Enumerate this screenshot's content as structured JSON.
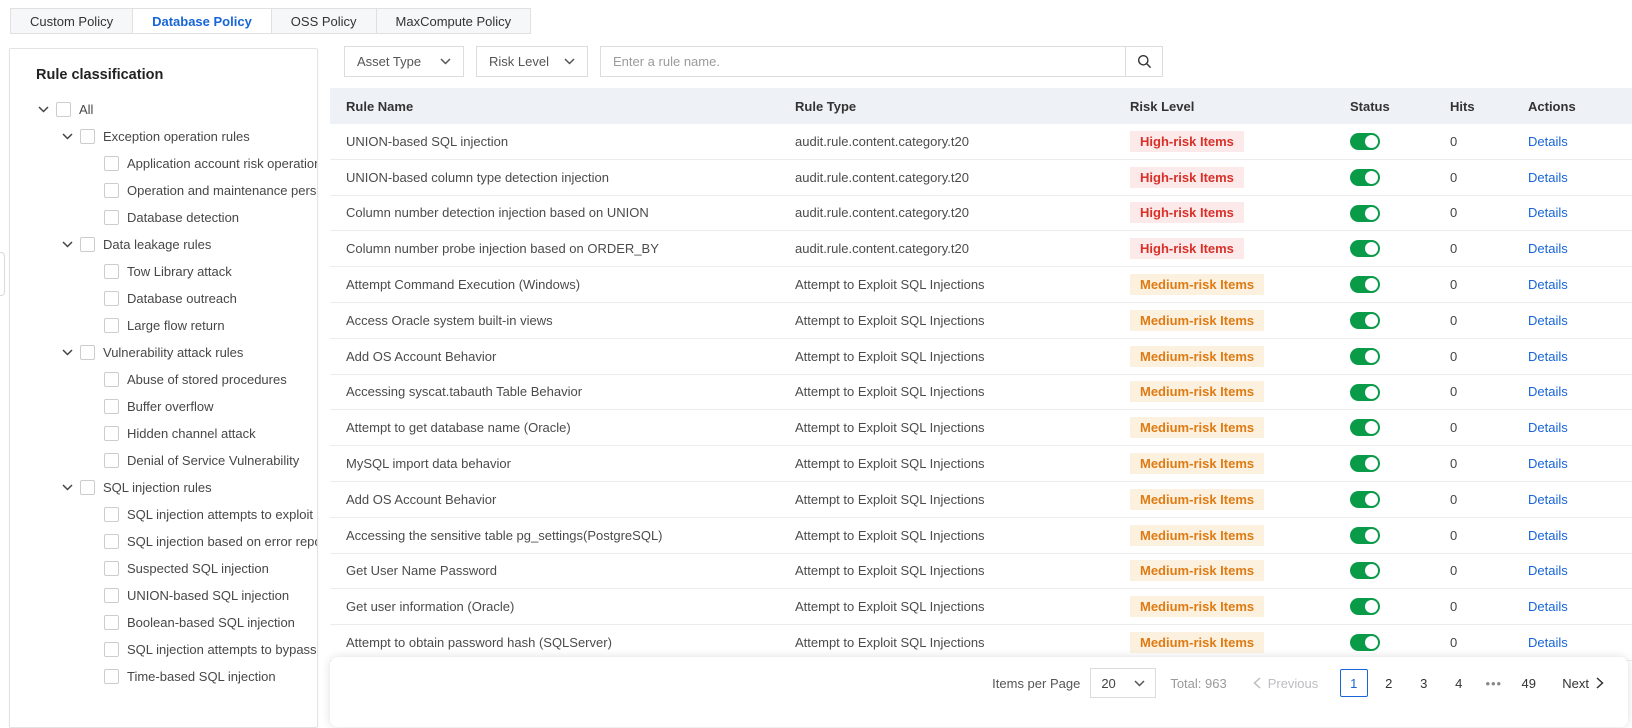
{
  "colors": {
    "accent_blue": "#1765D8",
    "toggle_on_green": "#0A9B49",
    "high_risk_text": "#D9312A",
    "high_risk_bg": "#FCE9E9",
    "medium_risk_text": "#DE7B12",
    "medium_risk_bg": "#FCF0DF",
    "table_header_bg": "#EEF1F6"
  },
  "tabs": [
    {
      "label": "Custom Policy",
      "active": false
    },
    {
      "label": "Database Policy",
      "active": true
    },
    {
      "label": "OSS Policy",
      "active": false
    },
    {
      "label": "MaxCompute Policy",
      "active": false
    }
  ],
  "sidebar": {
    "title": "Rule classification",
    "tree": [
      {
        "label": "All",
        "level": 0,
        "expandable": true,
        "expanded": true
      },
      {
        "label": "Exception operation rules",
        "level": 1,
        "expandable": true,
        "expanded": true
      },
      {
        "label": "Application account risk operation",
        "level": 2,
        "expandable": false
      },
      {
        "label": "Operation and maintenance personnel ri",
        "level": 2,
        "expandable": false
      },
      {
        "label": "Database detection",
        "level": 2,
        "expandable": false
      },
      {
        "label": "Data leakage rules",
        "level": 1,
        "expandable": true,
        "expanded": true
      },
      {
        "label": "Tow Library attack",
        "level": 2,
        "expandable": false
      },
      {
        "label": "Database outreach",
        "level": 2,
        "expandable": false
      },
      {
        "label": "Large flow return",
        "level": 2,
        "expandable": false
      },
      {
        "label": "Vulnerability attack rules",
        "level": 1,
        "expandable": true,
        "expanded": true
      },
      {
        "label": "Abuse of stored procedures",
        "level": 2,
        "expandable": false
      },
      {
        "label": "Buffer overflow",
        "level": 2,
        "expandable": false
      },
      {
        "label": "Hidden channel attack",
        "level": 2,
        "expandable": false
      },
      {
        "label": "Denial of Service Vulnerability",
        "level": 2,
        "expandable": false
      },
      {
        "label": "SQL injection rules",
        "level": 1,
        "expandable": true,
        "expanded": true
      },
      {
        "label": "SQL injection attempts to exploit",
        "level": 2,
        "expandable": false
      },
      {
        "label": "SQL injection based on error reporting",
        "level": 2,
        "expandable": false
      },
      {
        "label": "Suspected SQL injection",
        "level": 2,
        "expandable": false
      },
      {
        "label": "UNION-based SQL injection",
        "level": 2,
        "expandable": false
      },
      {
        "label": "Boolean-based SQL injection",
        "level": 2,
        "expandable": false
      },
      {
        "label": "SQL injection attempts to bypass",
        "level": 2,
        "expandable": false
      },
      {
        "label": "Time-based SQL injection",
        "level": 2,
        "expandable": false
      }
    ]
  },
  "filters": {
    "asset_type_label": "Asset Type",
    "risk_level_label": "Risk Level",
    "search_placeholder": "Enter a rule name."
  },
  "table": {
    "columns": [
      "Rule Name",
      "Rule Type",
      "Risk Level",
      "Status",
      "Hits",
      "Actions"
    ],
    "risk_labels": {
      "high": "High-risk Items",
      "medium": "Medium-risk Items"
    },
    "action_label": "Details",
    "rows": [
      {
        "name": "UNION-based SQL injection",
        "type": "audit.rule.content.category.t20",
        "risk": "high",
        "status": "on",
        "hits": "0"
      },
      {
        "name": "UNION-based column type detection injection",
        "type": "audit.rule.content.category.t20",
        "risk": "high",
        "status": "on",
        "hits": "0"
      },
      {
        "name": "Column number detection injection based on UNION",
        "type": "audit.rule.content.category.t20",
        "risk": "high",
        "status": "on",
        "hits": "0"
      },
      {
        "name": "Column number probe injection based on ORDER_BY",
        "type": "audit.rule.content.category.t20",
        "risk": "high",
        "status": "on",
        "hits": "0"
      },
      {
        "name": "Attempt Command Execution (Windows)",
        "type": "Attempt to Exploit SQL Injections",
        "risk": "medium",
        "status": "on",
        "hits": "0"
      },
      {
        "name": "Access Oracle system built-in views",
        "type": "Attempt to Exploit SQL Injections",
        "risk": "medium",
        "status": "on",
        "hits": "0"
      },
      {
        "name": "Add OS Account Behavior",
        "type": "Attempt to Exploit SQL Injections",
        "risk": "medium",
        "status": "on",
        "hits": "0"
      },
      {
        "name": "Accessing syscat.tabauth Table Behavior",
        "type": "Attempt to Exploit SQL Injections",
        "risk": "medium",
        "status": "on",
        "hits": "0"
      },
      {
        "name": "Attempt to get database name (Oracle)",
        "type": "Attempt to Exploit SQL Injections",
        "risk": "medium",
        "status": "on",
        "hits": "0"
      },
      {
        "name": "MySQL import data behavior",
        "type": "Attempt to Exploit SQL Injections",
        "risk": "medium",
        "status": "on",
        "hits": "0"
      },
      {
        "name": "Add OS Account Behavior",
        "type": "Attempt to Exploit SQL Injections",
        "risk": "medium",
        "status": "on",
        "hits": "0"
      },
      {
        "name": "Accessing the sensitive table pg_settings(PostgreSQL)",
        "type": "Attempt to Exploit SQL Injections",
        "risk": "medium",
        "status": "on",
        "hits": "0"
      },
      {
        "name": "Get User Name Password",
        "type": "Attempt to Exploit SQL Injections",
        "risk": "medium",
        "status": "on",
        "hits": "0"
      },
      {
        "name": "Get user information (Oracle)",
        "type": "Attempt to Exploit SQL Injections",
        "risk": "medium",
        "status": "on",
        "hits": "0"
      },
      {
        "name": "Attempt to obtain password hash (SQLServer)",
        "type": "Attempt to Exploit SQL Injections",
        "risk": "medium",
        "status": "on",
        "hits": "0"
      }
    ]
  },
  "pagination": {
    "items_per_page_label": "Items per Page",
    "page_size": "20",
    "total_label": "Total: 963",
    "previous_label": "Previous",
    "next_label": "Next",
    "pages": [
      "1",
      "2",
      "3",
      "4",
      "•••",
      "49"
    ],
    "current_page": "1"
  }
}
